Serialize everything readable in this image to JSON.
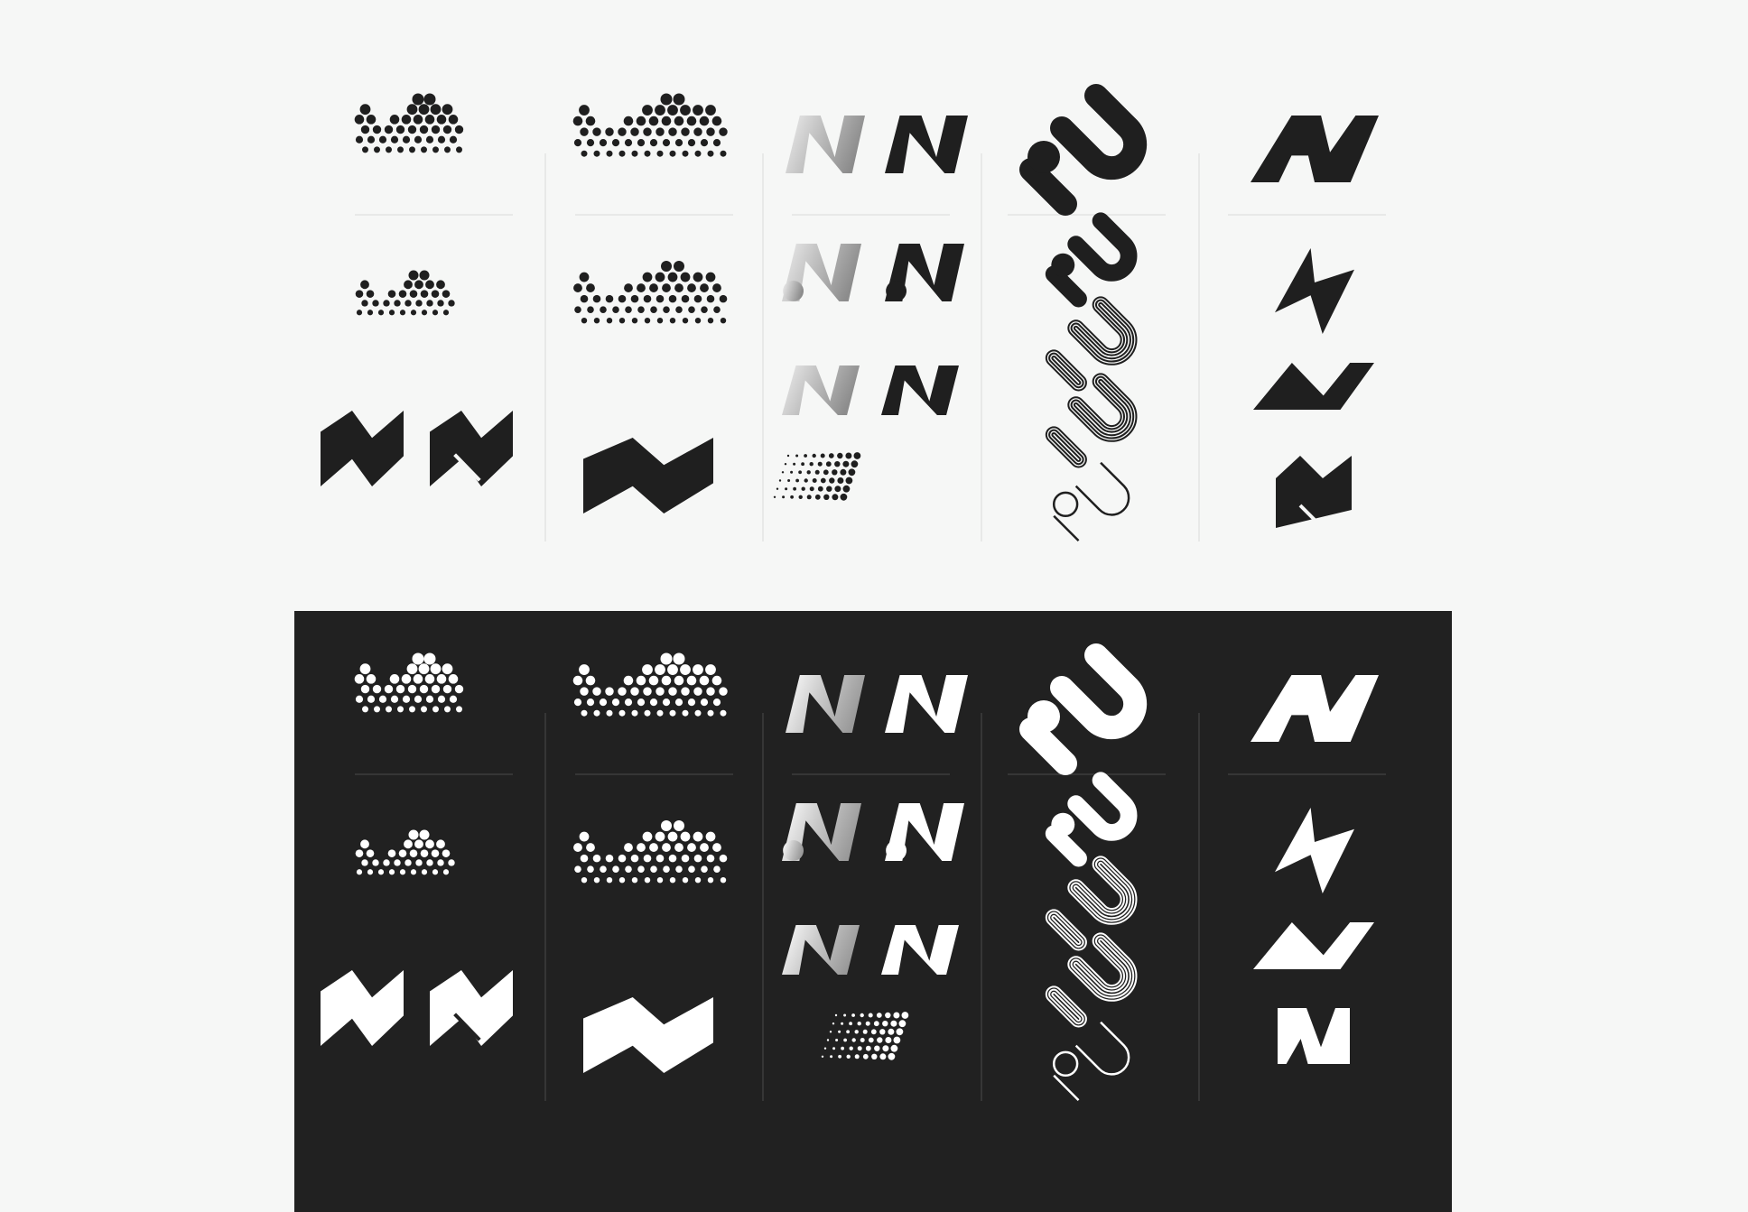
{
  "colors": {
    "page_background": "#f6f7f6",
    "dark_panel": "#212121",
    "ink_dark": "#1f1f1f",
    "ink_light": "#ffffff",
    "divider_light": "#d9dbd9",
    "divider_dark": "#4a4a4a",
    "metal_light": "#ececec",
    "metal_mid": "#b9b9b9",
    "metal_dark": "#8a8a8a"
  },
  "panels": [
    {
      "name": "light-panel",
      "theme": "light"
    },
    {
      "name": "dark-panel",
      "theme": "dark"
    }
  ],
  "columns": [
    {
      "name": "dotted-zigzag-column",
      "marks": [
        "dot-wave-large",
        "dot-wave-small",
        "zigzag-solid",
        "zigzag-cut"
      ]
    },
    {
      "name": "dotted-wave-column",
      "marks": [
        "dot-wave-large",
        "dot-wave-small",
        "zigzag-wide"
      ]
    },
    {
      "name": "n-letter-column",
      "marks": [
        "n-metal",
        "n-solid",
        "n-metal-loop",
        "n-solid-loop",
        "n-metal-italic",
        "n-solid-italic",
        "n-halftone"
      ]
    },
    {
      "name": "au-rounded-column",
      "marks": [
        "au-bold",
        "au-bold-small",
        "au-outline-stripes",
        "au-outline-stripes-2",
        "au-outline-thin"
      ]
    },
    {
      "name": "av-angular-column",
      "marks": [
        "av-wide",
        "av-tall",
        "av-flat",
        "av-block"
      ]
    }
  ]
}
